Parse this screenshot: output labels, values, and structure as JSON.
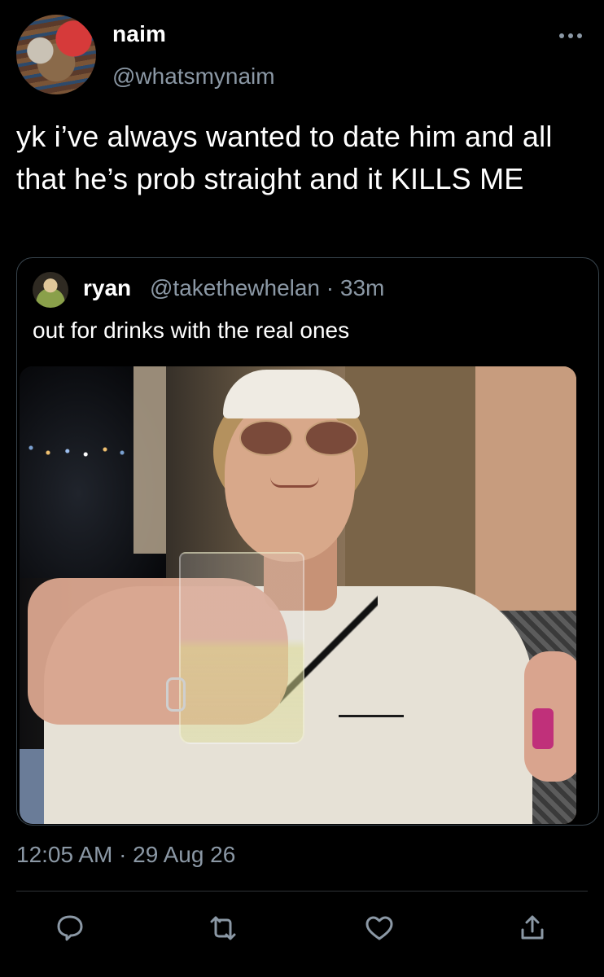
{
  "tweet": {
    "author": {
      "display_name": "naim",
      "handle": "@whatsmynaim"
    },
    "text": "yk i’ve always wanted to date him and all that he’s prob straight and it KILLS ME",
    "timestamp": "12:05 AM · 29 Aug 26"
  },
  "quoted_tweet": {
    "author": {
      "display_name": "ryan",
      "handle": "@takethewhelan"
    },
    "separator": "·",
    "age": "33m",
    "text": "out for drinks with the real ones"
  },
  "icons": {
    "more": "more-horizontal-icon",
    "reply": "reply-bubble-icon",
    "retweet": "retweet-icon",
    "like": "heart-icon",
    "share": "share-icon"
  },
  "colors": {
    "background": "#000000",
    "text": "#ffffff",
    "secondary": "#8b98a5",
    "border": "#38444d"
  }
}
